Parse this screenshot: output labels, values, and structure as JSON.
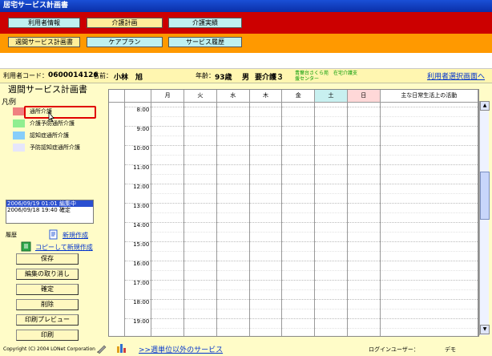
{
  "window": {
    "title": "居宅サービス計画書"
  },
  "nav": {
    "row1": [
      {
        "label": "利用者情報",
        "active": false
      },
      {
        "label": "介護計画",
        "active": true
      },
      {
        "label": "介護実績",
        "active": false
      }
    ],
    "row2": [
      {
        "label": "週間サービス計画書",
        "active": true
      },
      {
        "label": "ケアプラン",
        "active": false
      },
      {
        "label": "サービス履歴",
        "active": false
      }
    ]
  },
  "user": {
    "code_label": "利用者コード：",
    "code": "0600014126",
    "name_label": "名前：",
    "name": "小林　旭",
    "age_label": "年齢：",
    "age": "93歳",
    "gender": "男",
    "care_level": "要介護３",
    "facility_line1": "青葉台さくら苑　在宅介護支",
    "facility_line2": "援センター",
    "back_link": "利用者選択画面へ"
  },
  "page": {
    "heading": "週間サービス計画書"
  },
  "legend": {
    "title": "凡例",
    "items": [
      {
        "label": "通所介護",
        "color": "#f08080"
      },
      {
        "label": "介護予防通所介護",
        "color": "#90ee90"
      },
      {
        "label": "認知症通所介護",
        "color": "#87cefa"
      },
      {
        "label": "予防認知症通所介護",
        "color": "#e6e6fa"
      }
    ]
  },
  "history": {
    "label": "履歴",
    "entries": [
      {
        "text": "2006/09/19 01:01  編集中",
        "selected": true
      },
      {
        "text": "2006/09/18 19:40  確定",
        "selected": false
      }
    ],
    "new_link": "新規作成",
    "copy_link": "コピーして新規作成"
  },
  "actions": {
    "save": "保存",
    "cancel_edit": "編集の取り消し",
    "confirm": "確定",
    "delete": "削除",
    "print_preview": "印刷プレビュー",
    "print": "印刷"
  },
  "grid": {
    "days": [
      "月",
      "火",
      "水",
      "木",
      "金",
      "土",
      "日"
    ],
    "day_colors": {
      "土": "#c8f0f0",
      "日": "#ffd8d8"
    },
    "activity_header": "主な日常生活上の活動",
    "times": [
      "8:00",
      "9:00",
      "10:00",
      "11:00",
      "12:00",
      "13:00",
      "14:00",
      "15:00",
      "16:00",
      "17:00",
      "18:00",
      "19:00"
    ]
  },
  "footer": {
    "copyright": "Copyright (C) 2004 LONet Corporation",
    "other_services_link": ">>週単位以外のサービス",
    "login_label": "ログインユーザー：",
    "login_user": "デモ"
  }
}
